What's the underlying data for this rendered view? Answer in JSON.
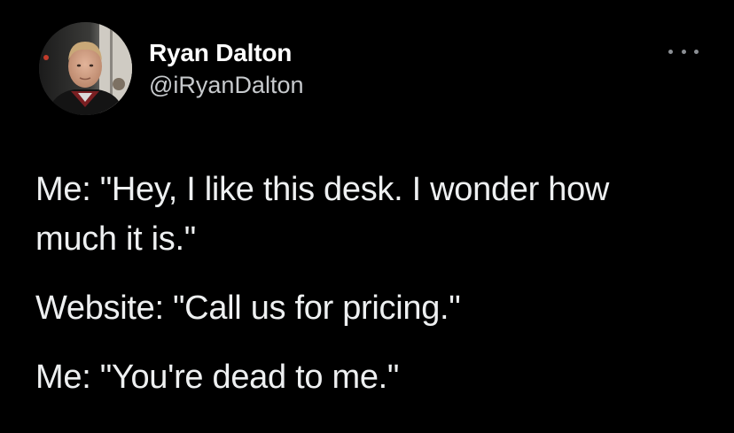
{
  "author": {
    "display_name": "Ryan Dalton",
    "handle": "@iRyanDalton"
  },
  "menu": {
    "icon": "more-horizontal-icon"
  },
  "tweet": {
    "paragraphs": [
      {
        "lines": [
          "Me: \"Hey, I like this desk. I wonder how",
          "much it is.\""
        ]
      },
      {
        "lines": [
          "Website: \"Call us for pricing.\""
        ]
      },
      {
        "lines": [
          "Me: \"You're dead to me.\""
        ]
      }
    ]
  },
  "colors": {
    "background": "#000000",
    "name": "#ffffff",
    "handle": "#c7cacd",
    "body_text": "#eef0f1",
    "menu_dots": "#8b8f94"
  }
}
